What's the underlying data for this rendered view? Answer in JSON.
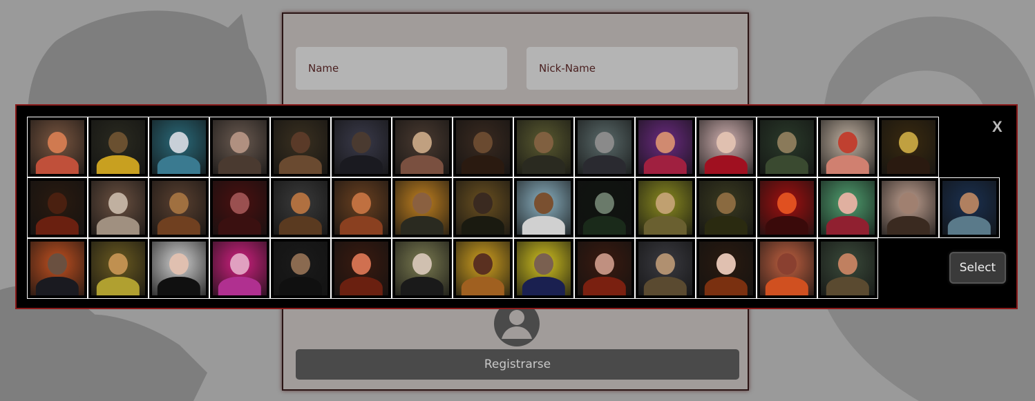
{
  "form": {
    "name_placeholder": "Name",
    "nickname_placeholder": "Nick-Name",
    "register_label": "Registrarse"
  },
  "picker": {
    "close_label": "X",
    "select_label": "Select",
    "rows": [
      [
        {
          "bg": "#7a5640",
          "skin": "#d07a50",
          "cloth": "#c0503a"
        },
        {
          "bg": "#2a2a20",
          "skin": "#6a5030",
          "cloth": "#c8a020"
        },
        {
          "bg": "#2a6a7a",
          "skin": "#c8d0d8",
          "cloth": "#3a7a90"
        },
        {
          "bg": "#6a5a50",
          "skin": "#b09080",
          "cloth": "#4a3a30"
        },
        {
          "bg": "#3a3020",
          "skin": "#5a3a28",
          "cloth": "#6a4a30"
        },
        {
          "bg": "#3a3a4a",
          "skin": "#4a3a30",
          "cloth": "#1a1a20"
        },
        {
          "bg": "#4a3a30",
          "skin": "#c0a080",
          "cloth": "#7a5040"
        },
        {
          "bg": "#3a2a20",
          "skin": "#6a4a30",
          "cloth": "#2a1a10"
        },
        {
          "bg": "#5a5a30",
          "skin": "#806040",
          "cloth": "#2a2a20"
        },
        {
          "bg": "#5a6a6a",
          "skin": "#8a8a8a",
          "cloth": "#2a2a30"
        },
        {
          "bg": "#6a2a80",
          "skin": "#d08a70",
          "cloth": "#a02040"
        },
        {
          "bg": "#d0b0b0",
          "skin": "#e0c0b0",
          "cloth": "#a01020"
        },
        {
          "bg": "#2a3a2a",
          "skin": "#8a7a5a",
          "cloth": "#3a4a30"
        },
        {
          "bg": "#c0b0a0",
          "skin": "#c04030",
          "cloth": "#d08070"
        },
        {
          "bg": "#3a2a10",
          "skin": "#c0a040",
          "cloth": "#2a1a10"
        }
      ],
      [
        {
          "bg": "#2a1a10",
          "skin": "#4a2010",
          "cloth": "#6a2010"
        },
        {
          "bg": "#6a5040",
          "skin": "#c0b0a0",
          "cloth": "#a09080"
        },
        {
          "bg": "#5a4030",
          "skin": "#a07040",
          "cloth": "#704020"
        },
        {
          "bg": "#4a1010",
          "skin": "#9a5050",
          "cloth": "#3a1010"
        },
        {
          "bg": "#3a3a3a",
          "skin": "#b07040",
          "cloth": "#5a3a20"
        },
        {
          "bg": "#6a4020",
          "skin": "#c07040",
          "cloth": "#8a4020"
        },
        {
          "bg": "#c08020",
          "skin": "#8a6040",
          "cloth": "#2a2a20"
        },
        {
          "bg": "#6a5020",
          "skin": "#3a2a20",
          "cloth": "#1a1a10"
        },
        {
          "bg": "#8ab0c0",
          "skin": "#7a5030",
          "cloth": "#d0d0d0"
        },
        {
          "bg": "#101410",
          "skin": "#6a7a6a",
          "cloth": "#1a2a1a"
        },
        {
          "bg": "#8a8a20",
          "skin": "#c0a070",
          "cloth": "#6a6030"
        },
        {
          "bg": "#3a3a20",
          "skin": "#8a6a40",
          "cloth": "#2a2a10"
        },
        {
          "bg": "#a01010",
          "skin": "#e05020",
          "cloth": "#3a0a0a"
        },
        {
          "bg": "#50a070",
          "skin": "#e0b0a0",
          "cloth": "#902030"
        },
        {
          "bg": "#c0a090",
          "skin": "#a08070",
          "cloth": "#3a2a20"
        },
        {
          "bg": "#1a3050",
          "skin": "#b08060",
          "cloth": "#5a7a8a"
        }
      ],
      [
        {
          "bg": "#c05020",
          "skin": "#6a5040",
          "cloth": "#1a1a20"
        },
        {
          "bg": "#6a5a20",
          "skin": "#c09050",
          "cloth": "#b0a030"
        },
        {
          "bg": "#d0d0d0",
          "skin": "#e0c0b0",
          "cloth": "#101010"
        },
        {
          "bg": "#d02080",
          "skin": "#e0a0c0",
          "cloth": "#b03090"
        },
        {
          "bg": "#1a1a1a",
          "skin": "#8a6a50",
          "cloth": "#101010"
        },
        {
          "bg": "#3a1a10",
          "skin": "#d07050",
          "cloth": "#6a2010"
        },
        {
          "bg": "#7a7a50",
          "skin": "#d0c0b0",
          "cloth": "#1a1a1a"
        },
        {
          "bg": "#d0a020",
          "skin": "#5a3020",
          "cloth": "#a06020"
        },
        {
          "bg": "#d0c020",
          "skin": "#7a6050",
          "cloth": "#1a2050"
        },
        {
          "bg": "#3a1a10",
          "skin": "#c09080",
          "cloth": "#7a2010"
        },
        {
          "bg": "#3a3a40",
          "skin": "#b09070",
          "cloth": "#5a4a30"
        },
        {
          "bg": "#2a1a10",
          "skin": "#e0c0b0",
          "cloth": "#7a3010"
        },
        {
          "bg": "#c06040",
          "skin": "#8a4030",
          "cloth": "#d05020"
        },
        {
          "bg": "#3a4a3a",
          "skin": "#c08060",
          "cloth": "#5a4a30"
        }
      ]
    ]
  }
}
